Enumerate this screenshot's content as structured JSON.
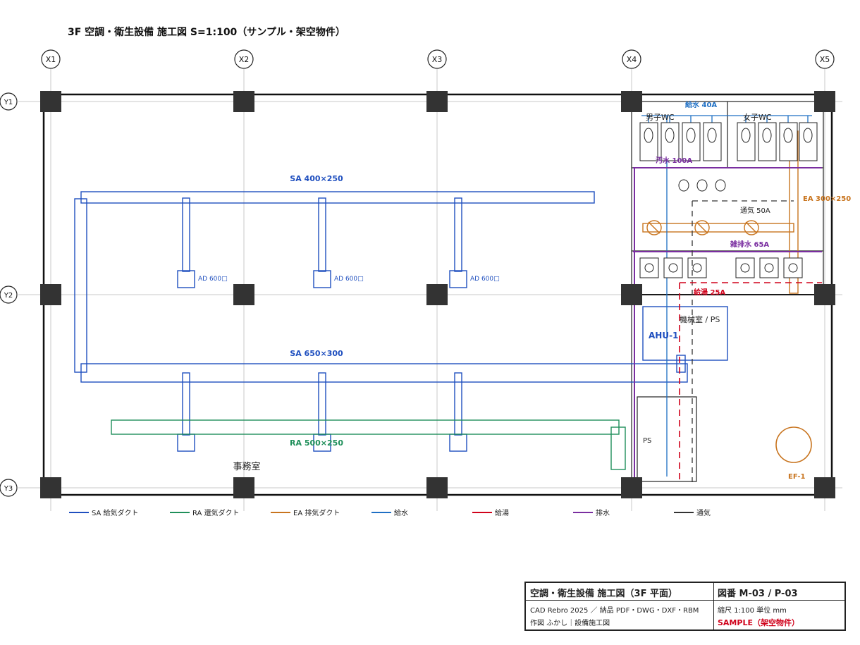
{
  "title": "3F 空調・衛生設備 施工図 S=1:100（サンプル・架空物件）",
  "grid": {
    "columns": [
      "X1",
      "X2",
      "X3",
      "X4",
      "X5"
    ],
    "rows": [
      "Y1",
      "Y2",
      "Y3"
    ]
  },
  "labels": {
    "sa_main": "SA 400×250",
    "sa_lower": "SA 650×300",
    "ra": "RA 500×250",
    "ad": "AD 600□",
    "office": "事務室",
    "wc_male": "男子WC",
    "wc_female": "女子WC",
    "water": "給水 40A",
    "sewage": "汚水 100A",
    "ventilation": "通気 50A",
    "misc_drain": "雑排水 65A",
    "hot_water": "給湯 25A",
    "ea": "EA 300×250",
    "mech_room": "機械室 / PS",
    "ahu": "AHU-1",
    "ps": "PS",
    "ef": "EF-1"
  },
  "legend": [
    {
      "label": "SA 給気ダクト",
      "color": "#1f4fbf"
    },
    {
      "label": "RA 還気ダクト",
      "color": "#1f8f5a"
    },
    {
      "label": "EA 排気ダクト",
      "color": "#c8741e"
    },
    {
      "label": "給水",
      "color": "#1e6fc4"
    },
    {
      "label": "給湯",
      "color": "#d0021b"
    },
    {
      "label": "排水",
      "color": "#7a2ea0"
    },
    {
      "label": "通気",
      "color": "#333333"
    }
  ],
  "titleblock": {
    "title": "空調・衛生設備 施工図（3F 平面）",
    "drawing_no": "図番 M-03 / P-03",
    "line1": "CAD Rebro 2025 ／ 納品 PDF・DWG・DXF・RBM",
    "line2": "作図 ふかし｜設備施工図",
    "scale": "縮尺 1:100 単位 mm",
    "sample": "SAMPLE（架空物件）"
  },
  "colors": {
    "sa": "#1f4fbf",
    "ra": "#1f8f5a",
    "ea": "#c8741e",
    "water": "#1e6fc4",
    "hot": "#d0021b",
    "drain": "#7a2ea0",
    "vent": "#333333",
    "column": "#333333"
  }
}
